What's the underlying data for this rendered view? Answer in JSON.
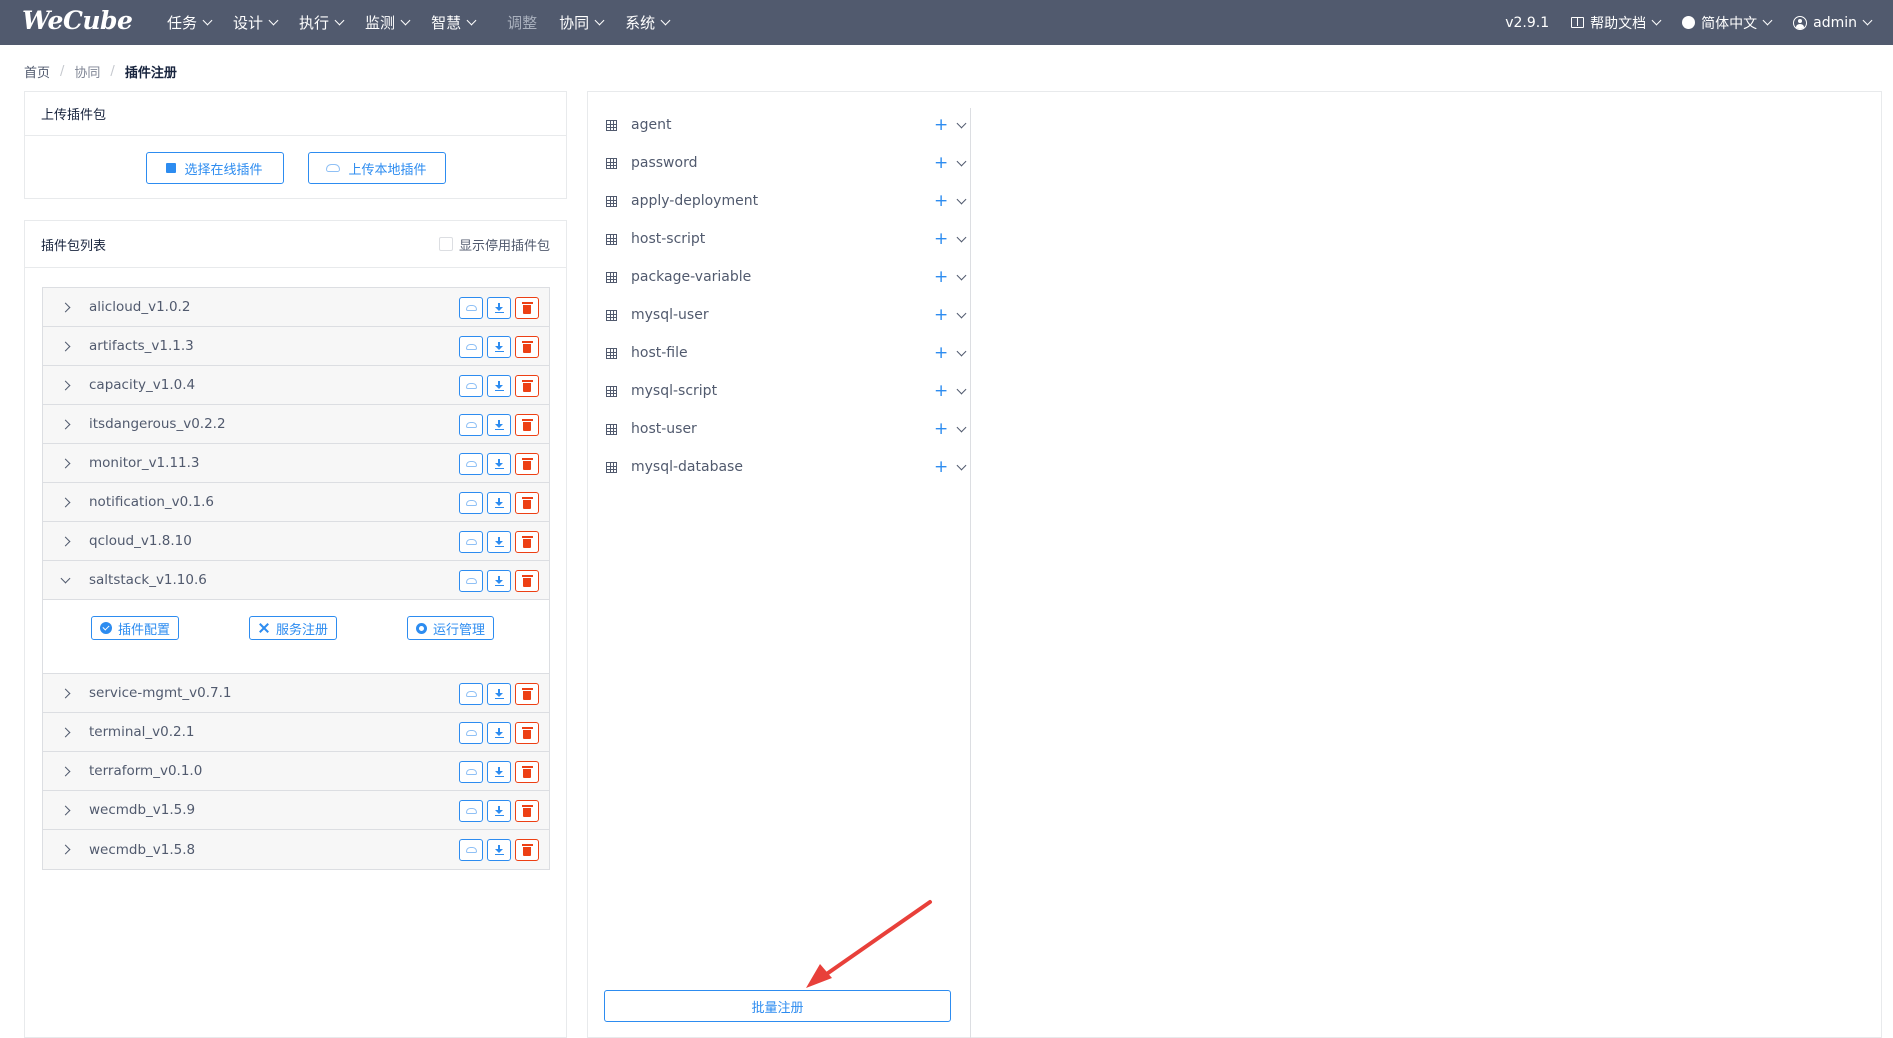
{
  "header": {
    "logo": "WeCube",
    "nav": [
      {
        "label": "任务",
        "dropdown": true
      },
      {
        "label": "设计",
        "dropdown": true
      },
      {
        "label": "执行",
        "dropdown": true
      },
      {
        "label": "监测",
        "dropdown": true
      },
      {
        "label": "智慧",
        "dropdown": true
      },
      {
        "label": "调整",
        "dropdown": false
      },
      {
        "label": "协同",
        "dropdown": true
      },
      {
        "label": "系统",
        "dropdown": true
      }
    ],
    "version": "v2.9.1",
    "help": "帮助文档",
    "language": "简体中文",
    "user": "admin"
  },
  "breadcrumb": [
    "首页",
    "协同",
    "插件注册"
  ],
  "upload": {
    "title": "上传插件包",
    "online_btn": "选择在线插件",
    "local_btn": "上传本地插件"
  },
  "plugin_list": {
    "title": "插件包列表",
    "show_disabled": "显示停用插件包",
    "packages": [
      {
        "name": "alicloud_v1.0.2",
        "expanded": false
      },
      {
        "name": "artifacts_v1.1.3",
        "expanded": false
      },
      {
        "name": "capacity_v1.0.4",
        "expanded": false
      },
      {
        "name": "itsdangerous_v0.2.2",
        "expanded": false
      },
      {
        "name": "monitor_v1.11.3",
        "expanded": false
      },
      {
        "name": "notification_v0.1.6",
        "expanded": false
      },
      {
        "name": "qcloud_v1.8.10",
        "expanded": false
      },
      {
        "name": "saltstack_v1.10.6",
        "expanded": true
      },
      {
        "name": "service-mgmt_v0.7.1",
        "expanded": false
      },
      {
        "name": "terminal_v0.2.1",
        "expanded": false
      },
      {
        "name": "terraform_v0.1.0",
        "expanded": false
      },
      {
        "name": "wecmdb_v1.5.9",
        "expanded": false
      },
      {
        "name": "wecmdb_v1.5.8",
        "expanded": false
      }
    ],
    "expanded_actions": [
      "插件配置",
      "服务注册",
      "运行管理"
    ]
  },
  "services": {
    "items": [
      "agent",
      "password",
      "apply-deployment",
      "host-script",
      "package-variable",
      "mysql-user",
      "host-file",
      "mysql-script",
      "host-user",
      "mysql-database"
    ],
    "plus_symbol": "+",
    "batch_btn": "批量注册"
  },
  "colors": {
    "header_bg": "#515a6e",
    "primary": "#2d8cf0",
    "danger": "#ed4014",
    "annotation_arrow": "#e8403a"
  }
}
